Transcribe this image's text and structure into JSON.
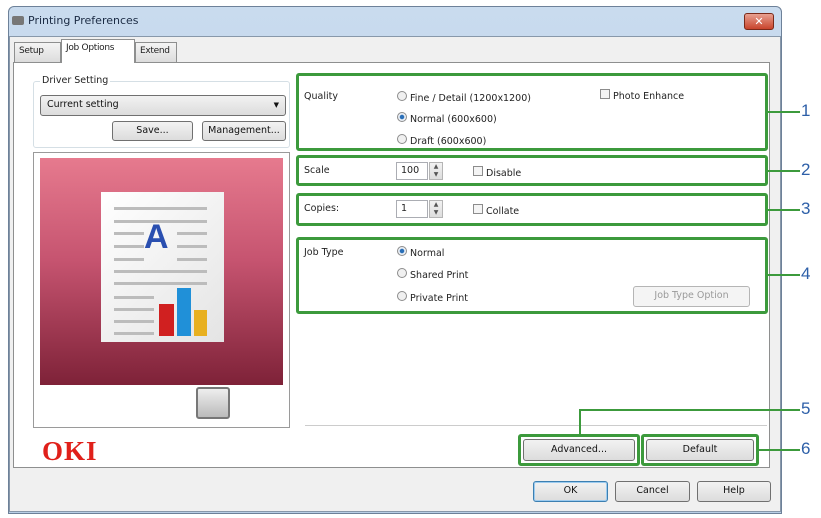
{
  "window": {
    "title": "Printing Preferences",
    "close_icon": "close-icon"
  },
  "tabs": [
    {
      "label": "Setup"
    },
    {
      "label": "Job Options",
      "active": true
    },
    {
      "label": "Extend"
    }
  ],
  "driver_setting": {
    "label": "Driver Setting",
    "selected": "Current setting",
    "save_label": "Save...",
    "management_label": "Management..."
  },
  "quality": {
    "label": "Quality",
    "options": [
      {
        "label": "Fine / Detail (1200x1200)",
        "selected": false
      },
      {
        "label": "Normal (600x600)",
        "selected": true
      },
      {
        "label": "Draft (600x600)",
        "selected": false
      }
    ],
    "photo_enhance_label": "Photo Enhance",
    "photo_enhance_checked": false
  },
  "scale": {
    "label": "Scale",
    "value": "100",
    "disable_label": "Disable",
    "disable_checked": false
  },
  "copies": {
    "label": "Copies:",
    "value": "1",
    "collate_label": "Collate",
    "collate_checked": false
  },
  "job_type": {
    "label": "Job Type",
    "options": [
      {
        "label": "Normal",
        "selected": true
      },
      {
        "label": "Shared Print",
        "selected": false
      },
      {
        "label": "Private Print",
        "selected": false
      }
    ],
    "option_button": "Job Type Option"
  },
  "buttons": {
    "advanced": "Advanced...",
    "default": "Default",
    "ok": "OK",
    "cancel": "Cancel",
    "help": "Help"
  },
  "brand": {
    "logo": "OKI",
    "color": "#e0201a"
  },
  "callouts": [
    "1",
    "2",
    "3",
    "4",
    "5",
    "6"
  ],
  "colors": {
    "highlight": "#3c9a3c",
    "callout": "#2d5fa8"
  }
}
